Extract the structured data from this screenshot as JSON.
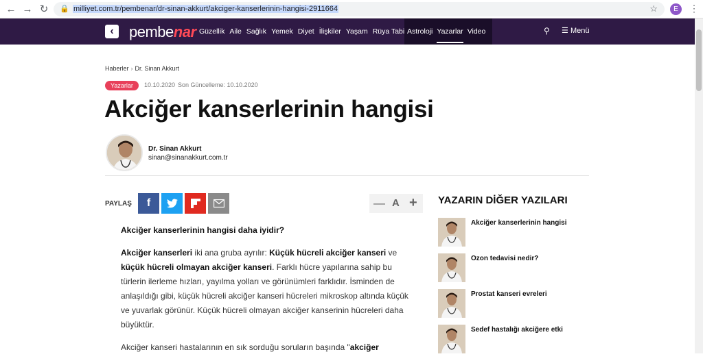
{
  "browser": {
    "url": "milliyet.com.tr/pembenar/dr-sinan-akkurt/akciger-kanserlerinin-hangisi-2911664",
    "profile_initial": "E"
  },
  "site": {
    "logo_part1": "pembe",
    "logo_part2": "nar",
    "menu": [
      "Güzellik",
      "Aile",
      "Sağlık",
      "Yemek",
      "Diyet",
      "İlişkiler",
      "Yaşam",
      "Rüya Tabirleri"
    ],
    "menu_dark": [
      "Astroloji",
      "Yazarlar",
      "Video"
    ],
    "menu_label": "Menü",
    "colors": {
      "nav_bg": "#2f1a45",
      "accent": "#ff4a57",
      "tag": "#e8405a"
    }
  },
  "article": {
    "breadcrumb": [
      "Haberler",
      "Dr. Sinan Akkurt"
    ],
    "tag": "Yazarlar",
    "date": "10.10.2020",
    "updated": "Son Güncelleme: 10.10.2020",
    "title": "Akciğer kanserlerinin hangisi",
    "author_name": "Dr. Sinan Akkurt",
    "author_email": "sinan@sinanakkurt.com.tr",
    "share_label": "PAYLAŞ",
    "font_minus": "—",
    "font_a": "A",
    "font_plus": "+",
    "subheading": "Akciğer kanserlerinin hangisi daha iyidir?",
    "p1_b1": "Akciğer kanserleri",
    "p1_t1": " iki ana gruba ayrılır: ",
    "p1_b2": "Küçük hücreli akciğer kanseri",
    "p1_t2": " ve ",
    "p1_b3": "küçük hücreli olmayan akciğer kanseri",
    "p1_t3": ". Farklı hücre yapılarına sahip bu türlerin ilerleme hızları, yayılma yolları ve görünümleri farklıdır. İsminden de anlaşıldığı gibi, küçük hücreli akciğer kanseri hücreleri mikroskop altında küçük ve yuvarlak görünür. Küçük hücreli olmayan akciğer kanserinin hücreleri daha büyüktür.",
    "p2_t1": "Akciğer kanseri hastalarının en sık sorduğu soruların başında \"",
    "p2_b1": "akciğer"
  },
  "sidebar": {
    "title": "YAZARIN DİĞER YAZILARI",
    "items": [
      {
        "title": "Akciğer kanserlerinin hangisi"
      },
      {
        "title": "Ozon tedavisi nedir?"
      },
      {
        "title": "Prostat kanseri evreleri"
      },
      {
        "title": "Sedef hastalığı akciğere etki"
      }
    ]
  }
}
